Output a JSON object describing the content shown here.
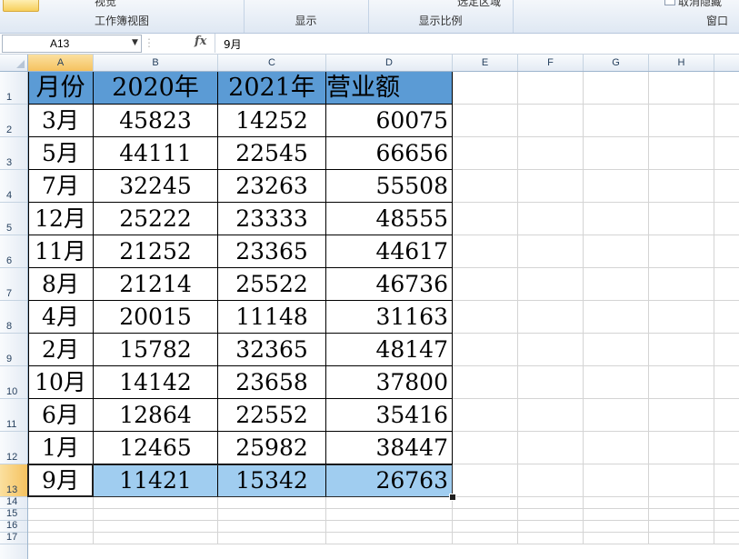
{
  "ribbon": {
    "groups": [
      {
        "label": "工作簿视图",
        "cut_text": "视觉"
      },
      {
        "label": "显示"
      },
      {
        "label": "显示比例",
        "cut_text": "选定区域"
      },
      {
        "label": "窗口",
        "cut_text": "取消隐藏"
      }
    ]
  },
  "formula_bar": {
    "name_box": "A13",
    "fx_label": "fx",
    "value": "9月"
  },
  "columns": [
    "A",
    "B",
    "C",
    "D",
    "E",
    "F",
    "G",
    "H"
  ],
  "rows": [
    "1",
    "2",
    "3",
    "4",
    "5",
    "6",
    "7",
    "8",
    "9",
    "10",
    "11",
    "12",
    "13",
    "14",
    "15",
    "16",
    "17"
  ],
  "sheet": {
    "headers": [
      "月份",
      "2020年",
      "2021年",
      "营业额"
    ],
    "data": [
      [
        "3月",
        "45823",
        "14252",
        "60075"
      ],
      [
        "5月",
        "44111",
        "22545",
        "66656"
      ],
      [
        "7月",
        "32245",
        "23263",
        "55508"
      ],
      [
        "12月",
        "25222",
        "23333",
        "48555"
      ],
      [
        "11月",
        "21252",
        "23365",
        "44617"
      ],
      [
        "8月",
        "21214",
        "25522",
        "46736"
      ],
      [
        "4月",
        "20015",
        "11148",
        "31163"
      ],
      [
        "2月",
        "15782",
        "32365",
        "48147"
      ],
      [
        "10月",
        "14142",
        "23658",
        "37800"
      ],
      [
        "6月",
        "12864",
        "22552",
        "35416"
      ],
      [
        "1月",
        "12465",
        "25982",
        "38447"
      ],
      [
        "9月",
        "11421",
        "15342",
        "26763"
      ]
    ]
  },
  "selection": {
    "active_cell": "A13"
  },
  "colors": {
    "header_fill": "#5b9bd5",
    "highlight_fill": "#a0cdf0",
    "selected_header": "#f5c25f"
  }
}
